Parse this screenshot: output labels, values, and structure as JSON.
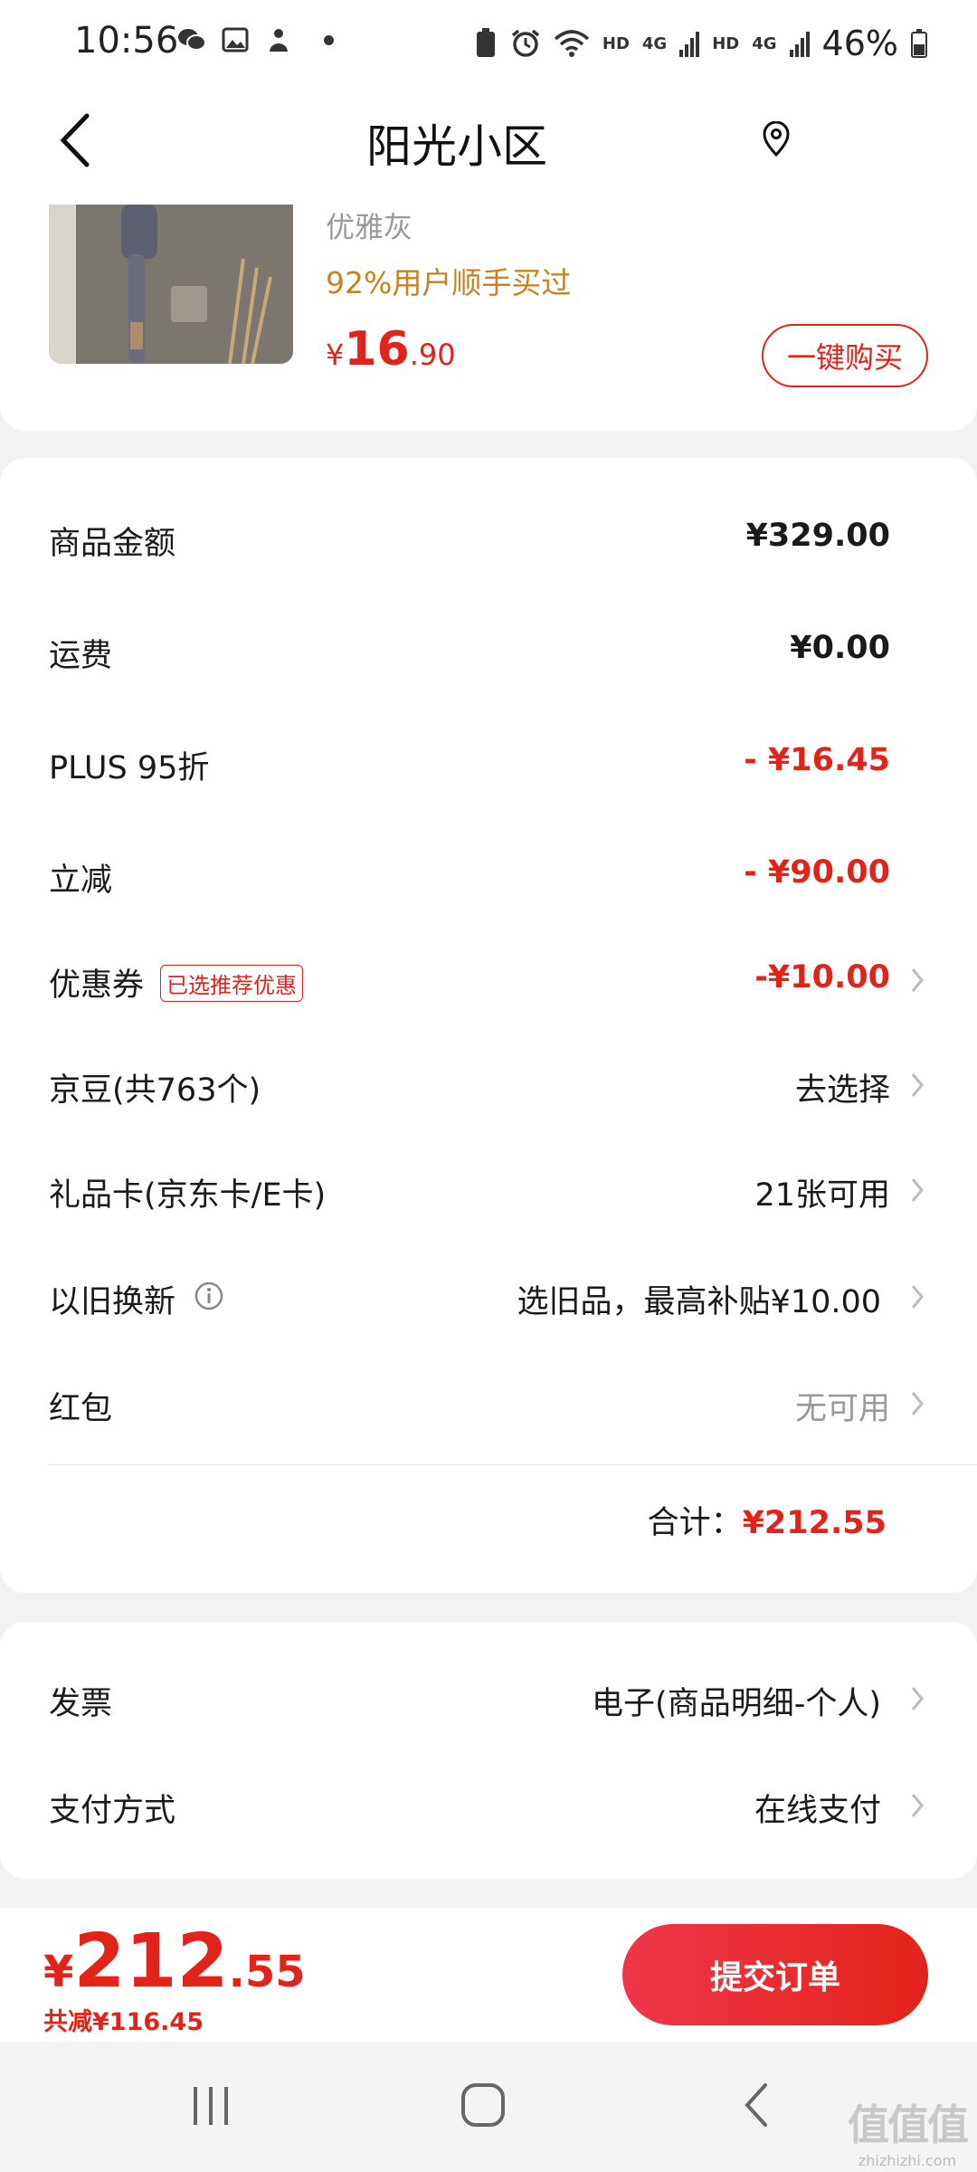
{
  "status_bar": {
    "time": "10:56",
    "net1": "HD",
    "net1_gen": "4G",
    "net2": "HD",
    "net2_gen": "4G",
    "battery": "46%"
  },
  "header": {
    "title": "阳光小区"
  },
  "product": {
    "spec": "优雅灰",
    "bought_text": "92%用户顺手买过",
    "price_currency": "¥",
    "price_int": "16",
    "price_dec": ".90",
    "buy_button": "一键购买"
  },
  "summary": {
    "rows": [
      {
        "label": "商品金额",
        "value": "¥329.00"
      },
      {
        "label": "运费",
        "value": "¥0.00"
      },
      {
        "label": "PLUS 95折",
        "value": "- ¥16.45"
      },
      {
        "label": "立减",
        "value": "- ¥90.00"
      },
      {
        "label": "优惠券",
        "tag": "已选推荐优惠",
        "value": "-¥10.00"
      },
      {
        "label": "京豆(共763个)",
        "value": "去选择"
      },
      {
        "label": "礼品卡(京东卡/E卡)",
        "value": "21张可用"
      },
      {
        "label": "以旧换新",
        "value": "选旧品，最高补贴¥10.00"
      },
      {
        "label": "红包",
        "value": "无可用"
      }
    ],
    "total_label": "合计：",
    "total_value": "¥212.55"
  },
  "invoice": {
    "rows": [
      {
        "label": "发票",
        "value": "电子(商品明细-个人)"
      },
      {
        "label": "支付方式",
        "value": "在线支付"
      }
    ]
  },
  "bottom_bar": {
    "currency": "¥",
    "price_int": "212",
    "price_dec": ".55",
    "saved": "共减¥116.45",
    "submit": "提交订单"
  },
  "watermark": {
    "logo": "值值值",
    "site": "zhizhizhi.com"
  },
  "colors": {
    "accent_red": "#e2231a",
    "bought_orange": "#c8821f"
  }
}
